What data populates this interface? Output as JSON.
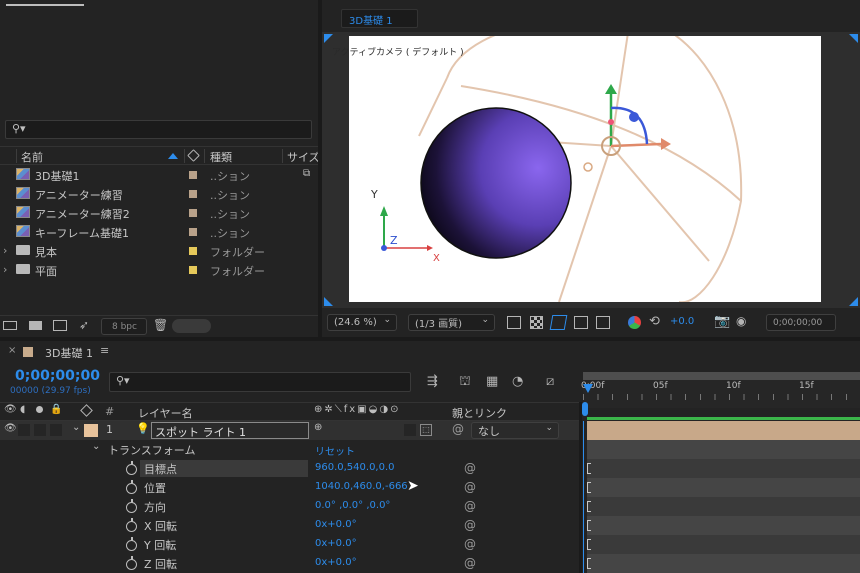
{
  "composition_tab": "3D基礎 1",
  "viewer": {
    "camera_label": "アクティブカメラ ( デフォルト )",
    "magnification": "(24.6 %)",
    "resolution": "(1/3 画質)",
    "exposure": "+0.0",
    "timecode": "0;00;00;00"
  },
  "project": {
    "search_icon": "search-icon",
    "columns": {
      "name": "名前",
      "type": "種類",
      "size": "サイズ"
    },
    "items": [
      {
        "name": "3D基礎1",
        "type": "..ション",
        "icon": "composition-icon",
        "label_color": "#b9a28a"
      },
      {
        "name": "アニメーター練習",
        "type": "..ション",
        "icon": "composition-icon",
        "label_color": "#b9a28a"
      },
      {
        "name": "アニメーター練習2",
        "type": "..ション",
        "icon": "composition-icon",
        "label_color": "#b9a28a"
      },
      {
        "name": "キーフレーム基礎1",
        "type": "..ション",
        "icon": "composition-icon",
        "label_color": "#b9a28a"
      },
      {
        "name": "見本",
        "type": "フォルダー",
        "icon": "folder-icon",
        "label_color": "#e6c95a"
      },
      {
        "name": "平面",
        "type": "フォルダー",
        "icon": "folder-icon",
        "label_color": "#e6c95a"
      }
    ],
    "bpc": "8 bpc"
  },
  "timeline": {
    "tab": "3D基礎 1",
    "timecode": "0;00;00;00",
    "frames": "00000 (29.97 fps)",
    "columns": {
      "num": "#",
      "layer_name": "レイヤー名",
      "parent": "親とリンク"
    },
    "ruler": [
      "0:00f",
      "05f",
      "10f",
      "15f"
    ],
    "layer": {
      "num": "1",
      "name": "スポット ライト 1",
      "parent": "なし",
      "label_color": "#e8c39c"
    },
    "transform": {
      "label": "トランスフォーム",
      "reset": "リセット"
    },
    "properties": [
      {
        "name": "目標点",
        "value": "960.0,540.0,0.0"
      },
      {
        "name": "位置",
        "value": "1040.0,460.0,-666"
      },
      {
        "name": "方向",
        "value": "0.0° ,0.0° ,0.0°"
      },
      {
        "name": "X 回転",
        "value": "0x+0.0°"
      },
      {
        "name": "Y 回転",
        "value": "0x+0.0°"
      },
      {
        "name": "Z 回転",
        "value": "0x+0.0°"
      }
    ]
  },
  "axis_labels": {
    "y": "Y",
    "z": "Z",
    "x": "X"
  },
  "colors": {
    "accent": "#2d8ceb",
    "panel": "#232323",
    "sphere": "#7a5ae0",
    "canvas": "#ffffff"
  }
}
